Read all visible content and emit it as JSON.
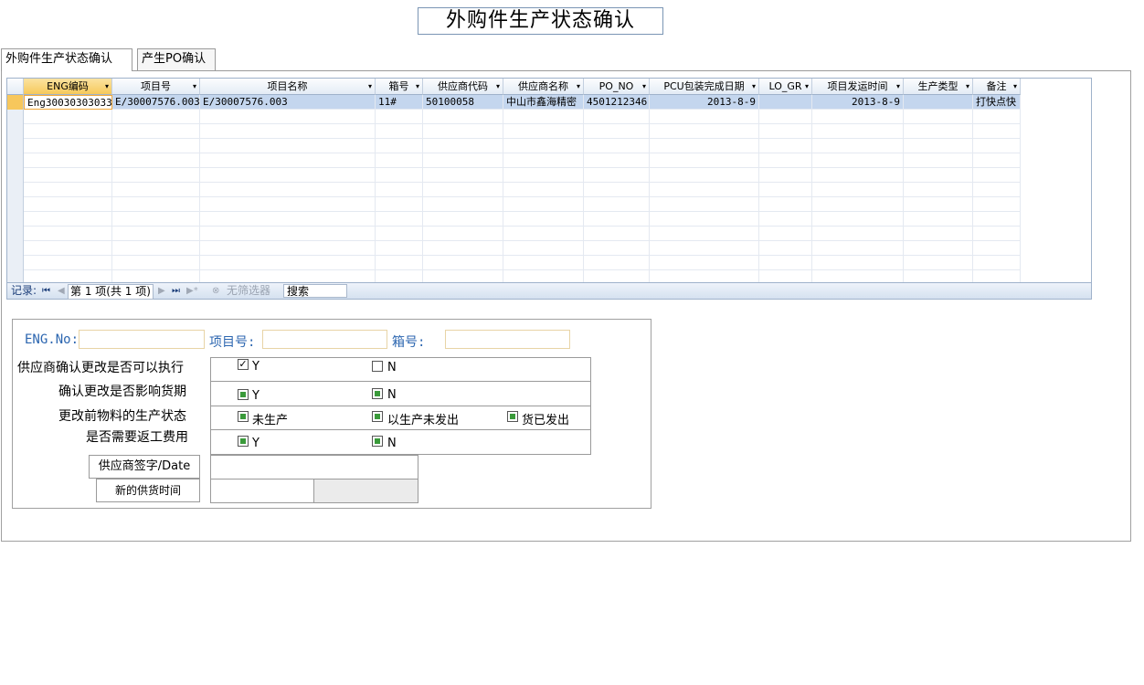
{
  "title": "外购件生产状态确认",
  "tabs": [
    {
      "label": "外购件生产状态确认",
      "active": true
    },
    {
      "label": "产生PO确认",
      "active": false
    }
  ],
  "grid": {
    "columns": [
      {
        "label": "ENG编码",
        "arrow": "▾"
      },
      {
        "label": "项目号",
        "arrow": "▾"
      },
      {
        "label": "项目名称",
        "arrow": "▾"
      },
      {
        "label": "箱号",
        "arrow": "▾"
      },
      {
        "label": "供应商代码",
        "arrow": "▾"
      },
      {
        "label": "供应商名称",
        "arrow": "▾"
      },
      {
        "label": "PO_NO",
        "arrow": "▾"
      },
      {
        "label": "PCU包装完成日期",
        "arrow": "▾"
      },
      {
        "label": "LO_GR",
        "arrow": "▾"
      },
      {
        "label": "项目发运时间",
        "arrow": "▾"
      },
      {
        "label": "生产类型",
        "arrow": "▾"
      },
      {
        "label": "备注",
        "arrow": "▾"
      }
    ],
    "rows": [
      [
        "Eng30030303033",
        "E/30007576.003",
        "E/30007576.003",
        "11#",
        "50100058",
        "中山市鑫海精密",
        "4501212346",
        "2013-8-9",
        "",
        "2013-8-9",
        "",
        "打快点快"
      ]
    ]
  },
  "navbar": {
    "record_label": "记录:",
    "first": "⏮",
    "prev": "◀",
    "record_text": "第 1 项(共 1 项)",
    "next": "▶",
    "last": "⏭",
    "new": "▶*",
    "filter_icon": "⊗",
    "filter_label": "无筛选器",
    "search_label": "搜索"
  },
  "form": {
    "eng_label": "ENG.No:",
    "project_label": "项目号:",
    "box_label": "箱号:",
    "q1_label": "供应商确认更改是否可以执行",
    "q2_label": "确认更改是否影响货期",
    "q3_label": "更改前物料的生产状态",
    "q4_label": "是否需要返工费用",
    "yes": "Y",
    "no": "N",
    "state1": "未生产",
    "state2": "以生产未发出",
    "state3": "货已发出",
    "sign_label": "供应商签字/Date",
    "supply_label": "新的供货时间"
  }
}
